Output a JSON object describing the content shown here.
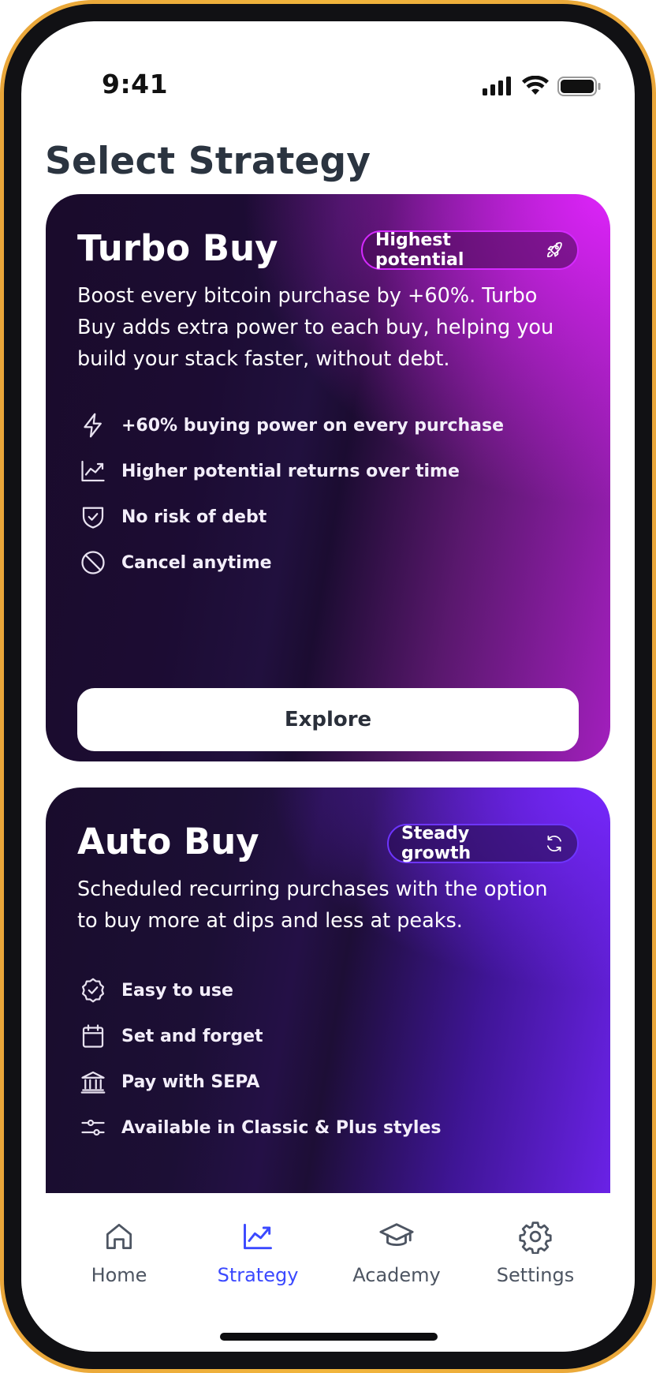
{
  "status_bar": {
    "time": "9:41"
  },
  "page": {
    "title": "Select Strategy"
  },
  "cards": {
    "turbo": {
      "title": "Turbo Buy",
      "badge": "Highest potential",
      "badge_icon": "rocket-icon",
      "description": "Boost every bitcoin purchase by +60%. Turbo Buy adds extra power to each buy, helping you build your stack faster, without debt.",
      "features": [
        {
          "icon": "lightning-icon",
          "label": "+60% buying power on every purchase"
        },
        {
          "icon": "chart-up-icon",
          "label": "Higher potential returns over time"
        },
        {
          "icon": "shield-check-icon",
          "label": "No risk of debt"
        },
        {
          "icon": "cancel-icon",
          "label": "Cancel anytime"
        }
      ],
      "button_label": "Explore",
      "accent": "#e224ff"
    },
    "auto": {
      "title": "Auto Buy",
      "badge": "Steady growth",
      "badge_icon": "refresh-icon",
      "description": "Scheduled recurring purchases with the option to buy more at dips and less at peaks.",
      "features": [
        {
          "icon": "badge-check-icon",
          "label": "Easy to use"
        },
        {
          "icon": "calendar-icon",
          "label": "Set and forget"
        },
        {
          "icon": "bank-icon",
          "label": "Pay with SEPA"
        },
        {
          "icon": "sliders-icon",
          "label": "Available in Classic & Plus styles"
        }
      ],
      "accent": "#7828ff"
    }
  },
  "nav": {
    "items": [
      {
        "label": "Home",
        "icon": "home-icon",
        "active": false
      },
      {
        "label": "Strategy",
        "icon": "chart-up-icon",
        "active": true
      },
      {
        "label": "Academy",
        "icon": "graduation-cap-icon",
        "active": false
      },
      {
        "label": "Settings",
        "icon": "gear-icon",
        "active": false
      }
    ],
    "active_color": "#3b49ff",
    "inactive_color": "#4d5562"
  }
}
